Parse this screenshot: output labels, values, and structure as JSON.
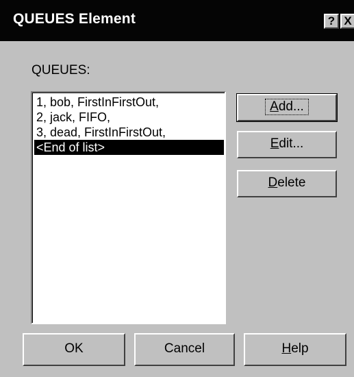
{
  "window": {
    "title": "QUEUES Element",
    "help_glyph": "?",
    "close_glyph": "X"
  },
  "queues": {
    "label": "QUEUES:",
    "items": [
      "1, bob, FirstInFirstOut,",
      "2, jack, FIFO,",
      "3, dead, FirstInFirstOut,",
      "<End of list>"
    ],
    "selected_index": 3
  },
  "side_buttons": {
    "add_mnemonic": "A",
    "add_rest": "dd...",
    "edit_mnemonic": "E",
    "edit_rest": "dit...",
    "delete_mnemonic": "D",
    "delete_rest": "elete"
  },
  "bottom_buttons": {
    "ok_label": "OK",
    "cancel_label": "Cancel",
    "help_mnemonic": "H",
    "help_rest": "elp"
  },
  "colors": {
    "face": "#c0c0c0",
    "titlebar": "#050505",
    "selection": "#000000"
  }
}
